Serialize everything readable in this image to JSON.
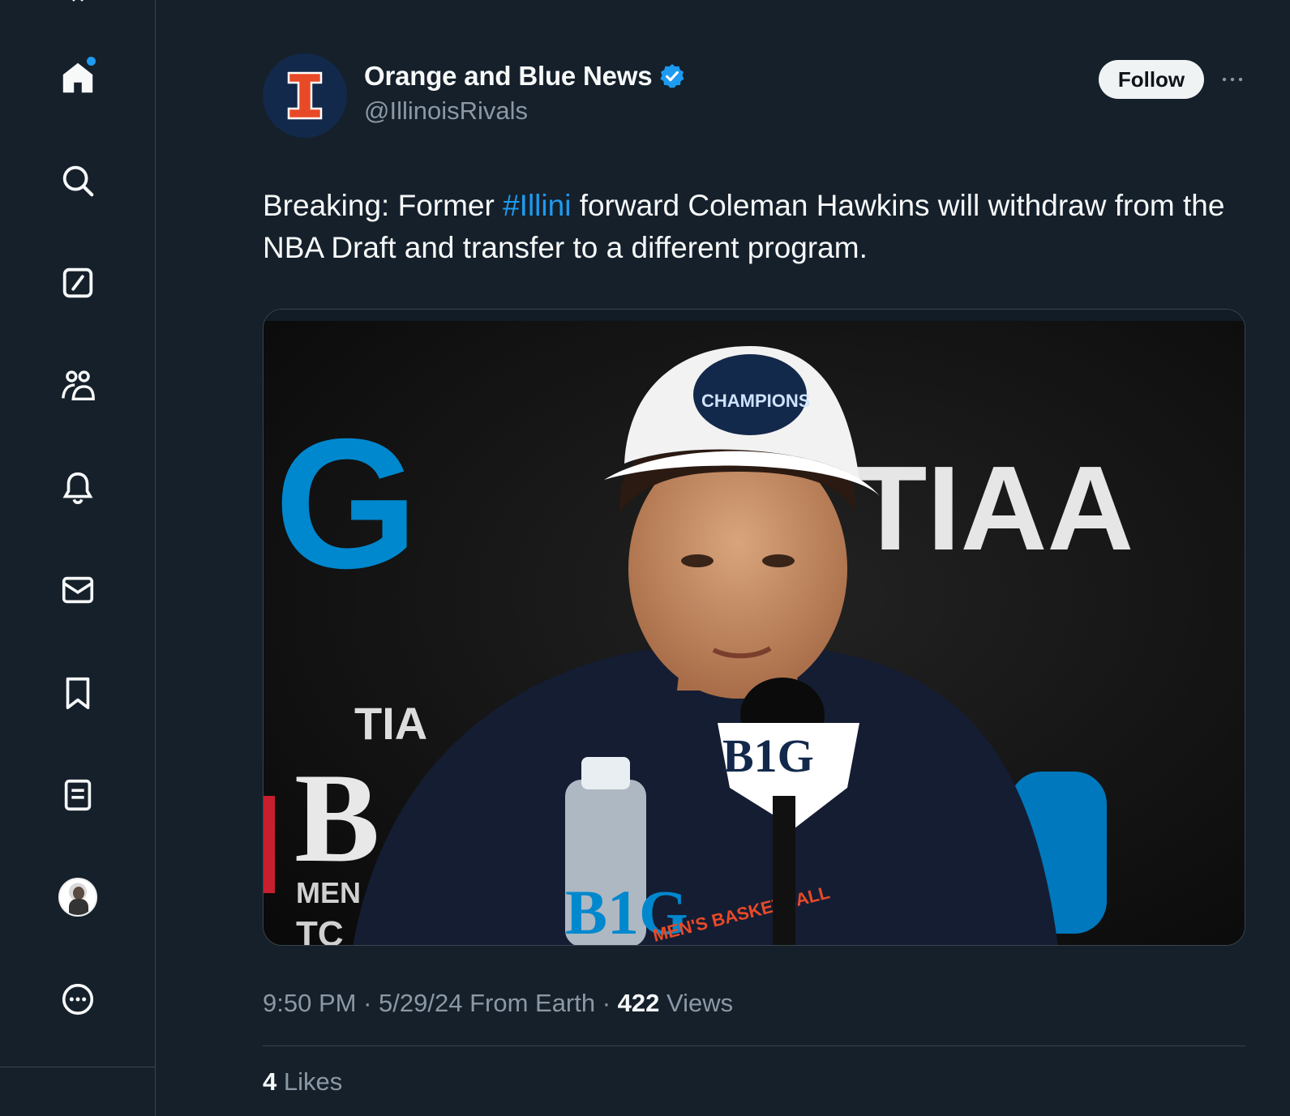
{
  "sidebar": {
    "items": [
      {
        "name": "home",
        "icon": "home-icon",
        "has_notification_dot": true
      },
      {
        "name": "explore",
        "icon": "search-icon"
      },
      {
        "name": "grok",
        "icon": "grok-icon"
      },
      {
        "name": "communities",
        "icon": "people-icon"
      },
      {
        "name": "notifications",
        "icon": "bell-icon"
      },
      {
        "name": "messages",
        "icon": "mail-icon"
      },
      {
        "name": "bookmarks",
        "icon": "bookmark-icon"
      },
      {
        "name": "lists",
        "icon": "list-icon"
      },
      {
        "name": "profile",
        "icon": "avatar"
      },
      {
        "name": "more",
        "icon": "more-circle-icon"
      }
    ]
  },
  "tweet": {
    "author_name": "Orange and Blue News",
    "author_handle": "@IllinoisRivals",
    "verified": true,
    "follow_label": "Follow",
    "text_before": "Breaking:  Former ",
    "hashtag": "#Illini",
    "text_after": " forward Coleman Hawkins will withdraw from the NBA Draft and transfer to a different program.",
    "media": {
      "description_icon": "press-conference-photo",
      "backdrop_text_left": "IG",
      "backdrop_text_right": "TIAA",
      "mic_flag_text": "B1G",
      "cap_text": "CHAMPIONS",
      "bottle_text": "B1G",
      "shirt_text": "MEN'S BASKETBALL",
      "left_small_text": "TIA",
      "left_big_letter": "B",
      "left_sub_text": "MEN",
      "left_sub_text2": "TC"
    },
    "time": "9:50 PM",
    "date": "5/29/24",
    "source": "From Earth",
    "views_count": "422",
    "views_label": "Views",
    "likes_count": "4",
    "likes_label": "Likes"
  },
  "colors": {
    "background": "#15202b",
    "accent": "#1d9bf0",
    "secondary_text": "#8b98a5",
    "illinois_orange": "#e84a27",
    "illinois_blue": "#13294b",
    "big_ten_blue": "#0088ce"
  }
}
